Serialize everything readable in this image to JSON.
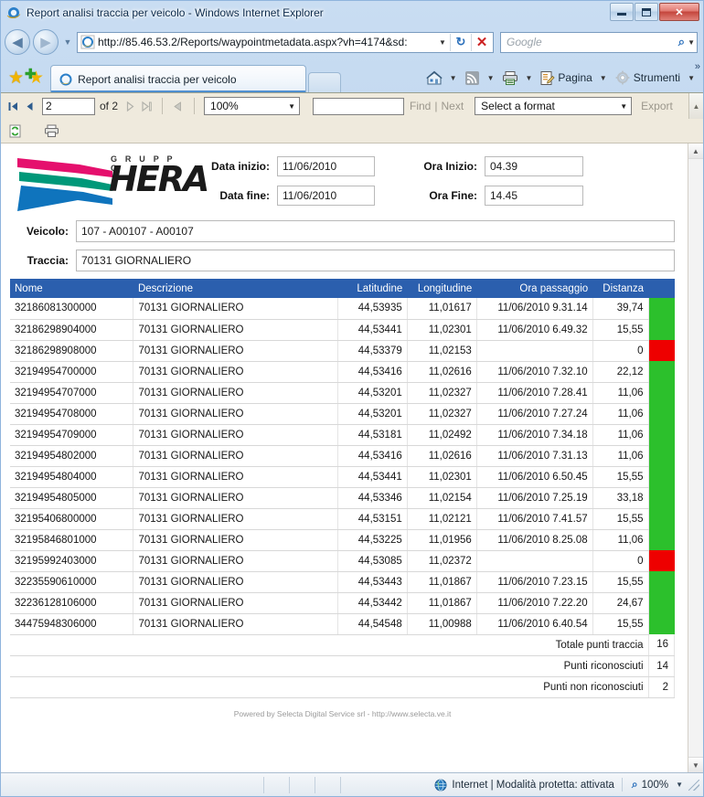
{
  "window": {
    "title": "Report analisi traccia per veicolo - Windows Internet Explorer",
    "minimize_label": "Riduci a icona",
    "maximize_label": "Ingrandisci",
    "close_label": "Chiudi"
  },
  "nav": {
    "back_label": "Indietro",
    "forward_label": "Avanti",
    "history_label": "Pagine recenti",
    "url": "http://85.46.53.2/Reports/waypointmetadata.aspx?vh=4174&sd:",
    "url_dropdown_label": "Cronologia",
    "refresh_label": "Aggiorna",
    "stop_label": "Interrompi",
    "search_placeholder": "Google",
    "search_value": ""
  },
  "tabs": {
    "favorites_label": "Preferiti",
    "add_favorite_label": "Aggiungi ai preferiti",
    "items": [
      {
        "label": "Report analisi traccia per veicolo",
        "active": true
      }
    ],
    "new_tab_label": "Nuova scheda"
  },
  "command_bar": {
    "home_label": "Pagina iniziale",
    "feeds_label": "Feed",
    "print_label": "Stampa",
    "page_label": "Pagina",
    "tools_label": "Strumenti",
    "overflow_label": "Altro"
  },
  "report_toolbar": {
    "first_page_label": "Prima pagina",
    "previous_page_label": "Pagina precedente",
    "current_page": "2",
    "of_label": "of 2",
    "next_page_label": "Pagina successiva",
    "last_page_label": "Ultima pagina",
    "back_to_parent_label": "Torna al report padre",
    "zoom_value": "100%",
    "find_value": "",
    "find_label": "Find",
    "find_separator": "|",
    "next_label": "Next",
    "format_value": "Select a format",
    "export_label": "Export",
    "refresh_label": "Aggiorna",
    "print_label": "Stampa"
  },
  "report": {
    "logo": {
      "gruppo_text": "G R U P P O",
      "brand_text": "HERA",
      "stripe_colors": [
        "#e5106d",
        "#009879",
        "#0f74bd"
      ]
    },
    "fields": {
      "data_inizio_label": "Data inizio:",
      "data_inizio_value": "11/06/2010",
      "data_fine_label": "Data fine:",
      "data_fine_value": "11/06/2010",
      "ora_inizio_label": "Ora Inizio:",
      "ora_inizio_value": "04.39",
      "ora_fine_label": "Ora Fine:",
      "ora_fine_value": "14.45",
      "veicolo_label": "Veicolo:",
      "veicolo_value": "107 - A00107 - A00107",
      "traccia_label": "Traccia:",
      "traccia_value": "70131 GIORNALIERO"
    },
    "table": {
      "header_color": "#2b5fae",
      "status_ok_color": "#2cc02c",
      "status_bad_color": "#ee0000",
      "columns": [
        "Nome",
        "Descrizione",
        "Latitudine",
        "Longitudine",
        "Ora passaggio",
        "Distanza",
        ""
      ],
      "rows": [
        {
          "nome": "32186081300000",
          "descrizione": "70131 GIORNALIERO",
          "latitudine": "44,53935",
          "longitudine": "11,01617",
          "ora_passaggio": "11/06/2010 9.31.14",
          "distanza": "39,74",
          "status": "ok"
        },
        {
          "nome": "32186298904000",
          "descrizione": "70131 GIORNALIERO",
          "latitudine": "44,53441",
          "longitudine": "11,02301",
          "ora_passaggio": "11/06/2010 6.49.32",
          "distanza": "15,55",
          "status": "ok"
        },
        {
          "nome": "32186298908000",
          "descrizione": "70131 GIORNALIERO",
          "latitudine": "44,53379",
          "longitudine": "11,02153",
          "ora_passaggio": "",
          "distanza": "0",
          "status": "bad"
        },
        {
          "nome": "32194954700000",
          "descrizione": "70131 GIORNALIERO",
          "latitudine": "44,53416",
          "longitudine": "11,02616",
          "ora_passaggio": "11/06/2010 7.32.10",
          "distanza": "22,12",
          "status": "ok"
        },
        {
          "nome": "32194954707000",
          "descrizione": "70131 GIORNALIERO",
          "latitudine": "44,53201",
          "longitudine": "11,02327",
          "ora_passaggio": "11/06/2010 7.28.41",
          "distanza": "11,06",
          "status": "ok"
        },
        {
          "nome": "32194954708000",
          "descrizione": "70131 GIORNALIERO",
          "latitudine": "44,53201",
          "longitudine": "11,02327",
          "ora_passaggio": "11/06/2010 7.27.24",
          "distanza": "11,06",
          "status": "ok"
        },
        {
          "nome": "32194954709000",
          "descrizione": "70131 GIORNALIERO",
          "latitudine": "44,53181",
          "longitudine": "11,02492",
          "ora_passaggio": "11/06/2010 7.34.18",
          "distanza": "11,06",
          "status": "ok"
        },
        {
          "nome": "32194954802000",
          "descrizione": "70131 GIORNALIERO",
          "latitudine": "44,53416",
          "longitudine": "11,02616",
          "ora_passaggio": "11/06/2010 7.31.13",
          "distanza": "11,06",
          "status": "ok"
        },
        {
          "nome": "32194954804000",
          "descrizione": "70131 GIORNALIERO",
          "latitudine": "44,53441",
          "longitudine": "11,02301",
          "ora_passaggio": "11/06/2010 6.50.45",
          "distanza": "15,55",
          "status": "ok"
        },
        {
          "nome": "32194954805000",
          "descrizione": "70131 GIORNALIERO",
          "latitudine": "44,53346",
          "longitudine": "11,02154",
          "ora_passaggio": "11/06/2010 7.25.19",
          "distanza": "33,18",
          "status": "ok"
        },
        {
          "nome": "32195406800000",
          "descrizione": "70131 GIORNALIERO",
          "latitudine": "44,53151",
          "longitudine": "11,02121",
          "ora_passaggio": "11/06/2010 7.41.57",
          "distanza": "15,55",
          "status": "ok"
        },
        {
          "nome": "32195846801000",
          "descrizione": "70131 GIORNALIERO",
          "latitudine": "44,53225",
          "longitudine": "11,01956",
          "ora_passaggio": "11/06/2010 8.25.08",
          "distanza": "11,06",
          "status": "ok"
        },
        {
          "nome": "32195992403000",
          "descrizione": "70131 GIORNALIERO",
          "latitudine": "44,53085",
          "longitudine": "11,02372",
          "ora_passaggio": "",
          "distanza": "0",
          "status": "bad"
        },
        {
          "nome": "32235590610000",
          "descrizione": "70131 GIORNALIERO",
          "latitudine": "44,53443",
          "longitudine": "11,01867",
          "ora_passaggio": "11/06/2010 7.23.15",
          "distanza": "15,55",
          "status": "ok"
        },
        {
          "nome": "32236128106000",
          "descrizione": "70131 GIORNALIERO",
          "latitudine": "44,53442",
          "longitudine": "11,01867",
          "ora_passaggio": "11/06/2010 7.22.20",
          "distanza": "24,67",
          "status": "ok"
        },
        {
          "nome": "34475948306000",
          "descrizione": "70131 GIORNALIERO",
          "latitudine": "44,54548",
          "longitudine": "11,00988",
          "ora_passaggio": "11/06/2010 6.40.54",
          "distanza": "15,55",
          "status": "ok"
        }
      ],
      "summary": [
        {
          "label": "Totale punti traccia",
          "value": "16"
        },
        {
          "label": "Punti riconosciuti",
          "value": "14"
        },
        {
          "label": "Punti non riconosciuti",
          "value": "2"
        }
      ]
    },
    "powered_by": "Powered by Selecta Digital Service srl - http://www.selecta.ve.it"
  },
  "status_bar": {
    "zone_text": "Internet | Modalità protetta: attivata",
    "zoom_text": "100%"
  }
}
